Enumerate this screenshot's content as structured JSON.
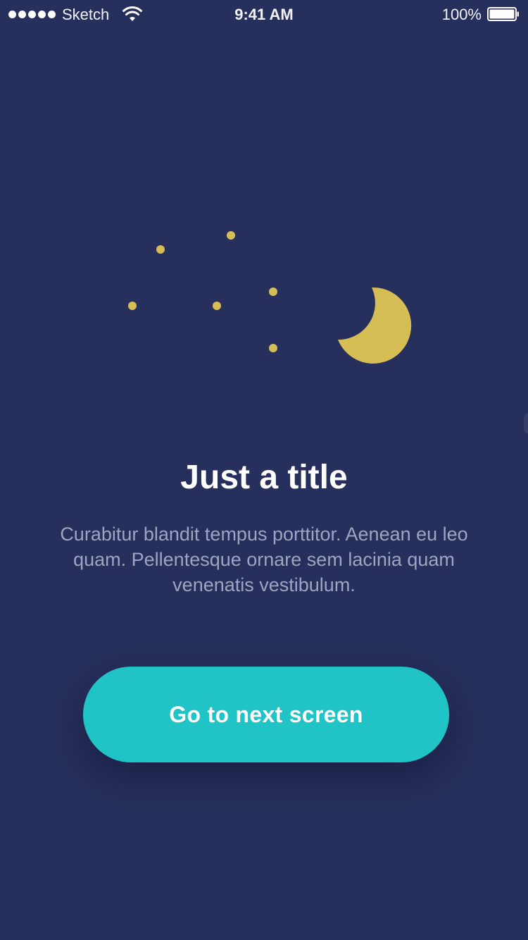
{
  "status_bar": {
    "carrier": "Sketch",
    "time": "9:41 AM",
    "battery_percent": "100%",
    "signal_bars": 5,
    "signal_icon": "signal-dots-icon",
    "wifi_icon": "wifi-icon",
    "battery_icon": "battery-icon",
    "battery_level": 1.0
  },
  "illustration": {
    "moon_icon": "crescent-moon-icon",
    "star_icon": "star-dot-icon",
    "accent_color": "#d6bd56"
  },
  "content": {
    "title": "Just a title",
    "body": "Curabitur blandit tempus porttitor. Aenean eu leo quam. Pellentesque ornare sem lacinia quam venenatis vestibulum."
  },
  "cta": {
    "label": "Go to next screen",
    "color": "#20c4c6"
  },
  "theme": {
    "background": "#272f5c",
    "text_primary": "#ffffff",
    "text_secondary": "#9ea4c1"
  }
}
